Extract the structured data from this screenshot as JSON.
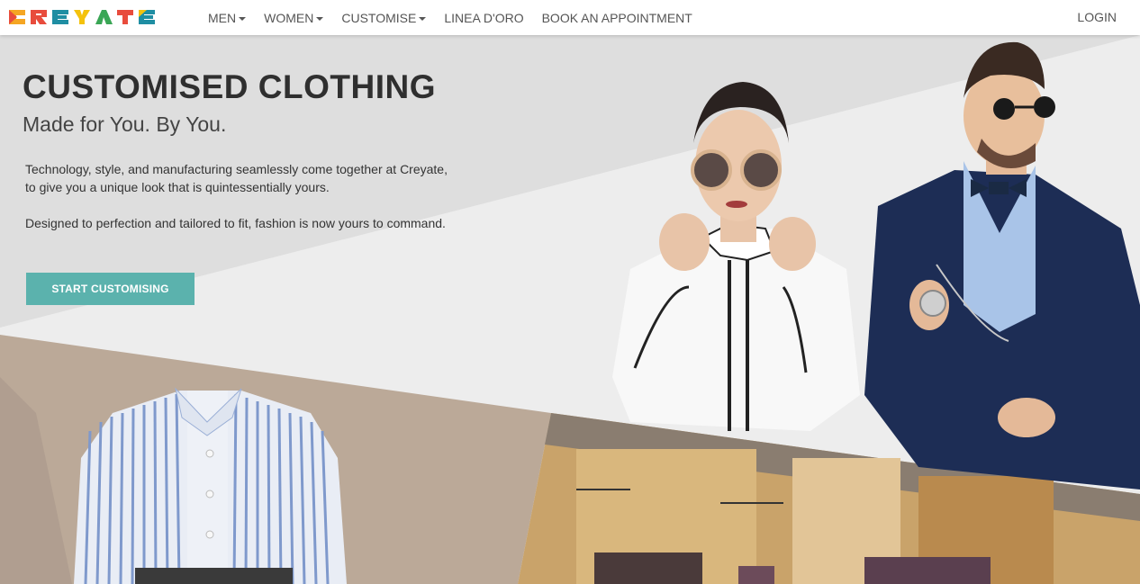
{
  "brand": {
    "logo_text": "CREYATE"
  },
  "nav": {
    "items": [
      {
        "label": "MEN",
        "dropdown": true
      },
      {
        "label": "WOMEN",
        "dropdown": true
      },
      {
        "label": "CUSTOMISE",
        "dropdown": true
      },
      {
        "label": "LINEA D'ORO",
        "dropdown": false
      },
      {
        "label": "BOOK AN APPOINTMENT",
        "dropdown": false
      }
    ],
    "login_label": "LOGIN"
  },
  "hero": {
    "title": "CUSTOMISED CLOTHING",
    "subtitle": "Made for You. By You.",
    "paragraph_1": "Technology, style, and manufacturing seamlessly come together at Creyate, to give you a unique look that is quintessentially yours.",
    "paragraph_2": "Designed to perfection and tailored to fit, fashion is now yours to command.",
    "cta_label": "START CUSTOMISING"
  },
  "colors": {
    "accent": "#5bb2ad",
    "logo": [
      "#f5a623",
      "#e84c3d",
      "#1f8ea3",
      "#f4c20d",
      "#3aa655",
      "#e84c3d",
      "#1f8ea3"
    ]
  },
  "images": [
    "woman-in-white-shirt-photo",
    "man-in-navy-suit-photo",
    "striped-shirt-3d-render",
    "store-interior-photo"
  ]
}
